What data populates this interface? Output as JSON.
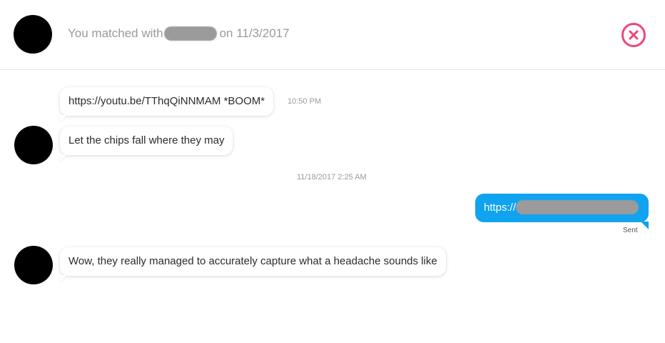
{
  "header": {
    "match_prefix": "You matched with",
    "match_suffix": "on 11/3/2017",
    "close_icon": "close-circle-icon",
    "accent_color": "#f0457a"
  },
  "messages": [
    {
      "text": "https://youtu.be/TThqQiNNMAM *BOOM*",
      "time": "10:50 PM",
      "direction": "received"
    },
    {
      "text": "Let the chips fall where they may",
      "direction": "received"
    },
    {
      "divider": "11/18/2017 2:25 AM"
    },
    {
      "text": "https://",
      "direction": "sent",
      "status": "Sent",
      "color": "#0fa3f0"
    },
    {
      "text": "Wow, they really managed to accurately capture what a headache sounds like",
      "direction": "received"
    }
  ]
}
